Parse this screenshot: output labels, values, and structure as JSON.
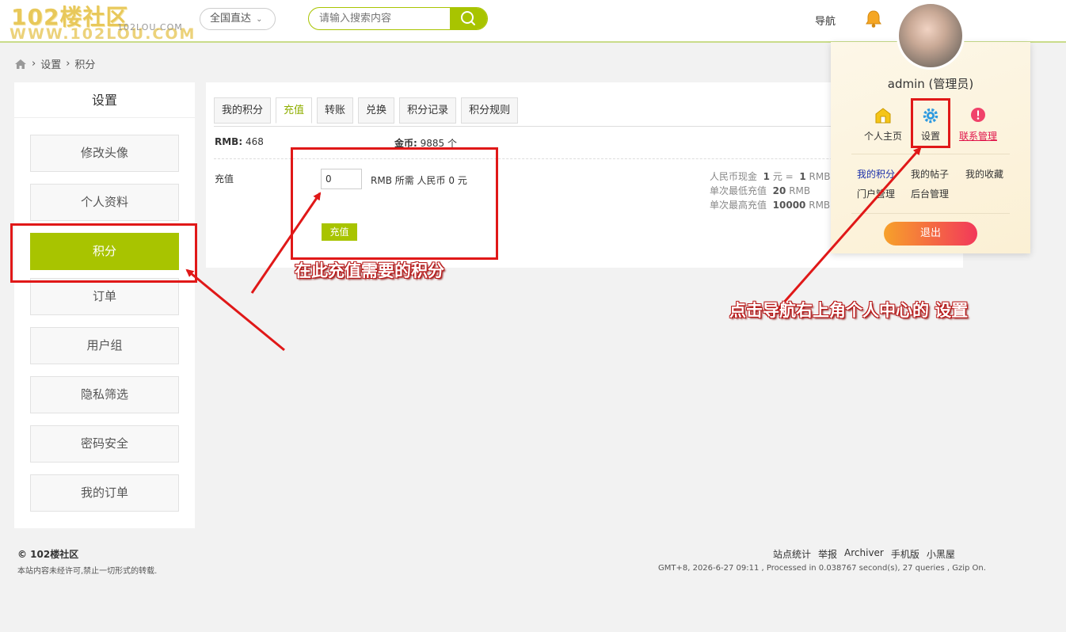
{
  "logo": {
    "title": "102楼社区",
    "url": "WWW.102LOU.COM",
    "small": "102LOU.COM"
  },
  "header": {
    "region": "全国直达",
    "search_placeholder": "请输入搜索内容",
    "nav": "导航"
  },
  "breadcrumb": {
    "items": [
      "设置",
      "积分"
    ]
  },
  "sidebar": {
    "title": "设置",
    "items": [
      "修改头像",
      "个人资料",
      "积分",
      "订单",
      "用户组",
      "隐私筛选",
      "密码安全",
      "我的订单"
    ],
    "active_index": 2
  },
  "tabs": [
    "我的积分",
    "充值",
    "转账",
    "兑换",
    "积分记录",
    "积分规则"
  ],
  "active_tab": 1,
  "balance": {
    "rmb_label": "RMB:",
    "rmb_value": "468",
    "coin_label": "金币:",
    "coin_value": "9885 个"
  },
  "recharge": {
    "label": "充值",
    "input_value": "0",
    "need_text": "RMB  所需 人民币 0 元",
    "submit": "充值"
  },
  "rules": {
    "line1_label": "人民币现金",
    "line1_a": "1",
    "line1_mid": "元 =",
    "line1_b": "1",
    "line1_unit": "RMB",
    "line2_label": "单次最低充值",
    "line2_value": "20",
    "line2_unit": "RMB",
    "line3_label": "单次最高充值",
    "line3_value": "10000",
    "line3_unit": "RMB"
  },
  "dropdown": {
    "name": "admin (管理员)",
    "icons": [
      "个人主页",
      "设置",
      "联系管理"
    ],
    "links": [
      "我的积分",
      "我的帖子",
      "我的收藏",
      "门户管理",
      "后台管理"
    ],
    "logout": "退出"
  },
  "footer": {
    "brand": "© 102楼社区",
    "note": "本站内容未经许可,禁止一切形式的转载.",
    "links": [
      "站点统计",
      "举报",
      "Archiver",
      "手机版",
      "小黑屋"
    ],
    "info": "GMT+8, 2026-6-27 09:11 , Processed in 0.038767 second(s), 27 queries , Gzip On."
  },
  "annotations": {
    "recharge_note": "在此充值需要的积分",
    "settings_note": "点击导航右上角个人中心的 设置"
  },
  "colors": {
    "accent": "#a8c400",
    "annotation": "#e01818",
    "logout_start": "#f7a12a",
    "logout_end": "#f2385a"
  }
}
